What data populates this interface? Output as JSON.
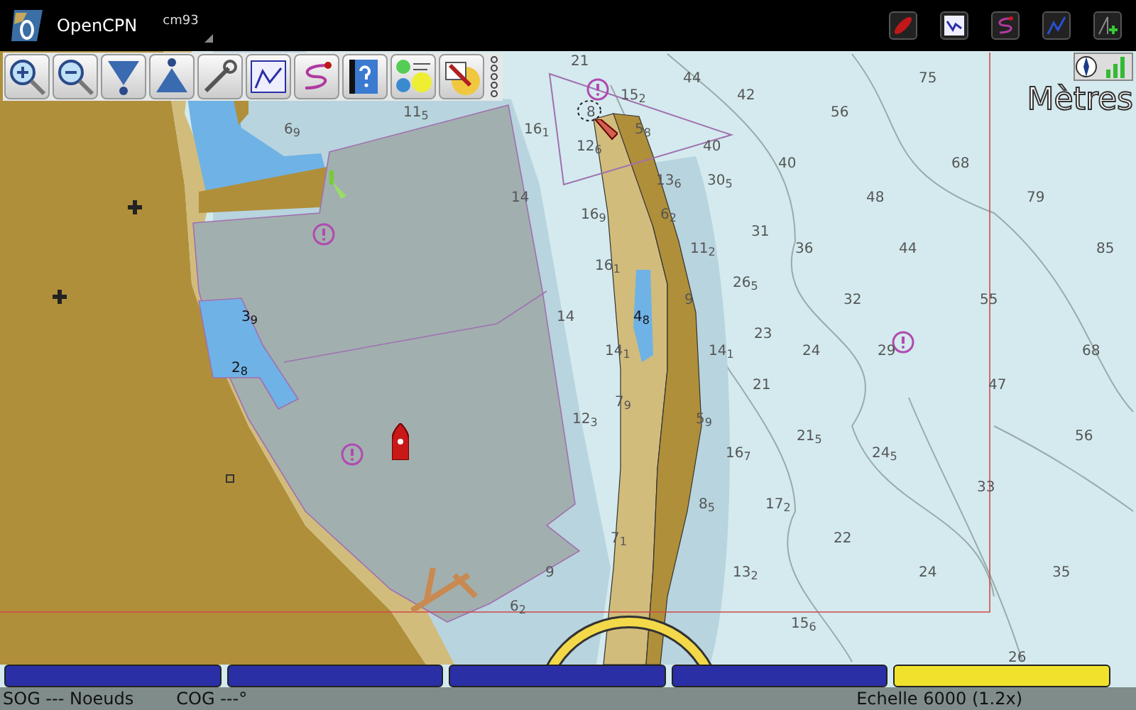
{
  "app_bar": {
    "title": "OpenCPN",
    "chart_set": "cm93"
  },
  "chart": {
    "units_label": "Mètres",
    "soundings": [
      "21",
      "44",
      "75",
      "15$_{2}$",
      "42",
      "11$_{5}$",
      "8",
      "56",
      "6$_{9}$",
      "16$_{1}$",
      "5$_{8}$",
      "12$_{6}$",
      "40",
      "40",
      "68",
      "13$_{6}$",
      "30$_{5}$",
      "14",
      "48",
      "79",
      "16$_{9}$",
      "6$_{2}$",
      "31",
      "11$_{2}$",
      "36",
      "44",
      "85",
      "16$_{1}$",
      "26$_{5}$",
      "9",
      "32",
      "55",
      "3$_{9}$",
      "14",
      "4$_{8}$",
      "23",
      "14$_{1}$",
      "14$_{1}$",
      "24",
      "29",
      "68",
      "2$_{8}$",
      "21",
      "47",
      "7$_{9}$",
      "12$_{3}$",
      "5$_{9}$",
      "21$_{5}$",
      "56",
      "16$_{7}$",
      "24$_{5}$",
      "33",
      "8$_{5}$",
      "17$_{2}$",
      "7$_{1}$",
      "22",
      "9",
      "13$_{2}$",
      "24",
      "35",
      "6$_{2}$",
      "15$_{6}$",
      "26"
    ]
  },
  "piano_keys": [
    {
      "selected": false
    },
    {
      "selected": false
    },
    {
      "selected": false
    },
    {
      "selected": false
    },
    {
      "selected": true
    }
  ],
  "status_bar": {
    "sog": "SOG --- Noeuds",
    "cog": "COG ---°",
    "scale": "Echelle 6000 (1.2x)"
  }
}
